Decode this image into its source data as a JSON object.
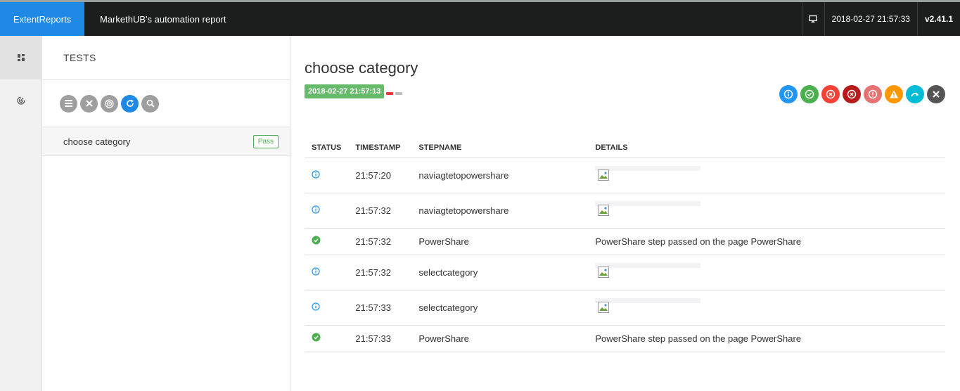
{
  "header": {
    "brand": "ExtentReports",
    "report_name": "MarkethUB's automation report",
    "datetime": "2018-02-27 21:57:33",
    "version": "v2.41.1"
  },
  "tests_panel": {
    "title": "TESTS",
    "tools": [
      "list-icon",
      "close-icon",
      "radar-icon",
      "refresh-icon",
      "search-icon"
    ],
    "tests": [
      {
        "name": "choose category",
        "status": "Pass"
      }
    ]
  },
  "detail": {
    "title": "choose category",
    "started": "2018-02-27 21:57:13",
    "columns": [
      "STATUS",
      "TIMESTAMP",
      "STEPNAME",
      "DETAILS"
    ],
    "steps": [
      {
        "status": "info",
        "timestamp": "21:57:20",
        "stepname": "naviagtetopowershare",
        "details": ""
      },
      {
        "status": "info",
        "timestamp": "21:57:32",
        "stepname": "naviagtetopowershare",
        "details": ""
      },
      {
        "status": "pass",
        "timestamp": "21:57:32",
        "stepname": "PowerShare",
        "details": "PowerShare step passed on the page PowerShare"
      },
      {
        "status": "info",
        "timestamp": "21:57:32",
        "stepname": "selectcategory",
        "details": ""
      },
      {
        "status": "info",
        "timestamp": "21:57:33",
        "stepname": "selectcategory",
        "details": ""
      },
      {
        "status": "pass",
        "timestamp": "21:57:33",
        "stepname": "PowerShare",
        "details": "PowerShare step passed on the page PowerShare"
      }
    ]
  },
  "colors": {
    "brand": "#1e88e5",
    "topbar": "#1b1e1d",
    "pass": "#4caf50",
    "info": "#2196f3",
    "fail": "#f44336",
    "fatal": "#b71c1c",
    "error": "#e57373",
    "warning": "#ff9800",
    "skip": "#00bcd4",
    "unknown": "#555555"
  }
}
